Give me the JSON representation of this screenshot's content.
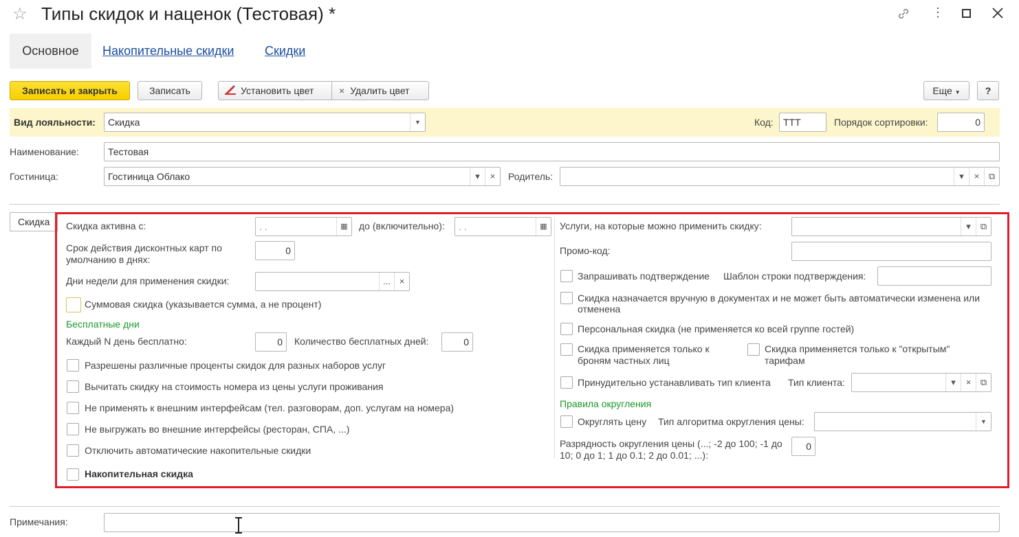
{
  "window": {
    "title": "Типы скидок и наценок (Тестовая) *"
  },
  "tabs": [
    {
      "label": "Основное"
    },
    {
      "label": "Накопительные скидки"
    },
    {
      "label": "Скидки"
    }
  ],
  "toolbar": {
    "save_close": "Записать и закрыть",
    "save": "Записать",
    "set_color": "Установить цвет",
    "delete_color": "Удалить цвет",
    "more": "Еще",
    "help": "?"
  },
  "header": {
    "loyalty_label": "Вид лояльности:",
    "loyalty_value": "Скидка",
    "code_label": "Код:",
    "code_value": "ТТТ",
    "sort_label": "Порядок сортировки:",
    "sort_value": "0"
  },
  "form": {
    "name_label": "Наименование:",
    "name_value": "Тестовая",
    "hotel_label": "Гостиница:",
    "hotel_value": "Гостиница Облако",
    "parent_label": "Родитель:",
    "parent_value": ""
  },
  "group_tab": "Скидка",
  "left": {
    "active_from": "Скидка активна с:",
    "date_placeholder": " .  .",
    "active_to": "до (включительно):",
    "card_term": "Срок действия дисконтных карт по умолчанию в днях:",
    "card_term_value": "0",
    "weekdays": "Дни недели для применения скидки:",
    "sum_discount": "Суммовая скидка (указывается сумма, а не процент)",
    "free_days_header": "Бесплатные дни",
    "every_n": "Каждый N день бесплатно:",
    "every_n_value": "0",
    "free_count": "Количество бесплатных дней:",
    "free_count_value": "0",
    "checks": [
      "Разрешены различные проценты скидок для разных наборов услуг",
      "Вычитать скидку на стоимость номера из цены услуги проживания",
      "Не применять к внешним интерфейсам (тел. разговорам, доп. услугам на номера)",
      "Не выгружать во внешние интерфейсы (ресторан, СПА, ...)",
      "Отключить автоматические накопительные скидки"
    ],
    "cumulative": "Накопительная скидка"
  },
  "right": {
    "services": "Услуги, на которые можно применить скидку:",
    "promo": "Промо-код:",
    "ask_confirm": "Запрашивать подтверждение",
    "confirm_template": "Шаблон строки подтверждения:",
    "manual": "Скидка назначается вручную в документах и не может быть автоматически изменена или отменена",
    "personal": "Персональная скидка (не применяется ко всей группе гостей)",
    "private_only": "Скидка применяется только к броням частных лиц",
    "open_only": "Скидка применяется только к \"открытым\" тарифам",
    "force_client": "Принудительно устанавливать тип клиента",
    "client_type": "Тип клиента:",
    "rounding_header": "Правила округления",
    "round_price": "Округлять цену",
    "algo": "Тип алгоритма округления цены:",
    "digits": "Разрядность округления цены (...; -2 до 100; -1 до 10; 0 до 1; 1 до 0.1; 2 до 0.01; ...):",
    "digits_value": "0"
  },
  "notes": {
    "label": "Примечания:",
    "value": ""
  },
  "colors": {
    "accent_yellow": "#f7cf00",
    "highlight": "#e21c27",
    "link": "#1a4fa0",
    "group_green": "#1a9a2a"
  }
}
